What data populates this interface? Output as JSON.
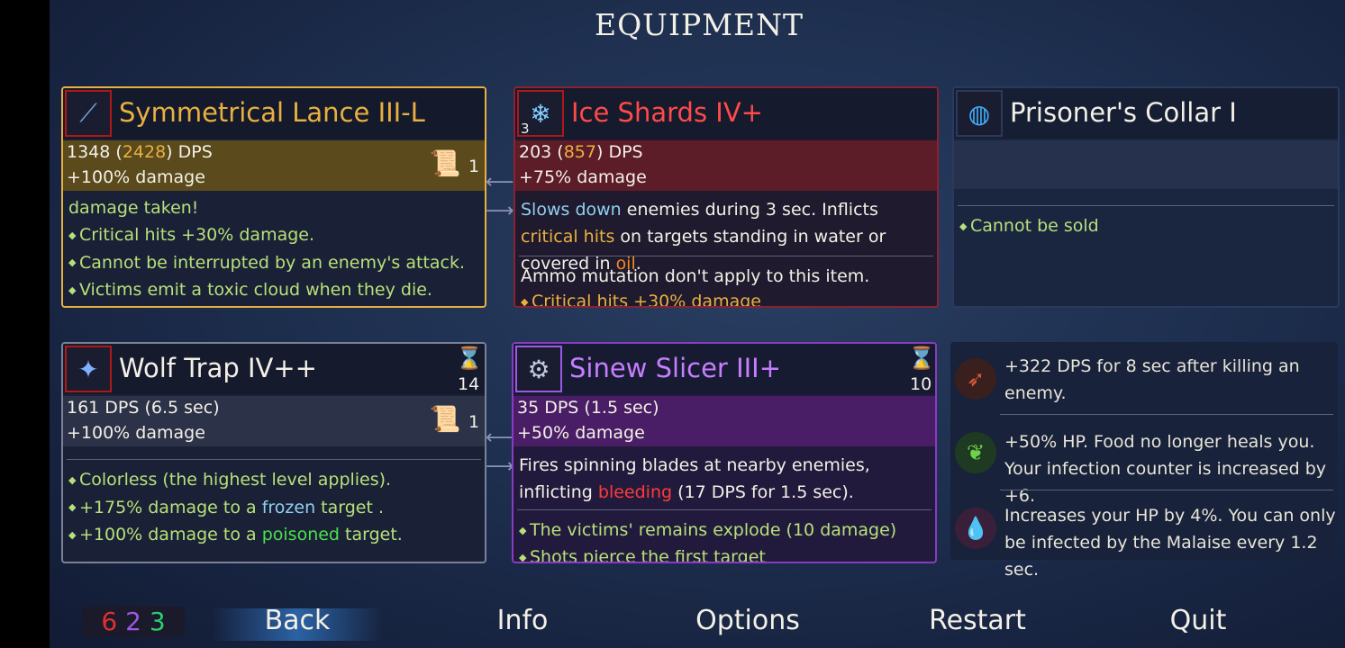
{
  "screen_title": "EQUIPMENT",
  "items": [
    {
      "name": "Symmetrical Lance III-L",
      "icon": "lance-icon",
      "dps_base": "1348",
      "dps_crit": "2428",
      "dps_suffix": "DPS",
      "damage_bonus": "+100% damage",
      "scroll_count": "1",
      "lines": [
        "damage taken!",
        "Critical hits +30% damage.",
        "Cannot be interrupted by an enemy's attack.",
        "Victims emit a toxic cloud when they die."
      ]
    },
    {
      "name": "Ice Shards IV+",
      "icon": "ice-shards-icon",
      "ammo": "3",
      "dps_base": "203",
      "dps_crit": "857",
      "dps_suffix": "DPS",
      "damage_bonus": "+75% damage",
      "desc_a": "Slows down",
      "desc_b": " enemies during 3 sec. Inflicts ",
      "desc_c": "critical hits",
      "desc_d": " on targets standing in water or covered in ",
      "desc_e": "oil",
      "desc_f": ".",
      "note": "Ammo mutation don't apply to this item.",
      "cut_line": "Critical hits +30% damage"
    },
    {
      "name": "Prisoner's Collar I",
      "icon": "collar-icon",
      "lines": [
        "Cannot be sold"
      ]
    },
    {
      "name": "Wolf Trap IV++",
      "icon": "wolf-trap-icon",
      "cooldown": "14",
      "dps": "161 DPS (6.5 sec)",
      "damage_bonus": "+100% damage",
      "scroll_count": "1",
      "line1": "Colorless (the highest level applies).",
      "line2_a": "+175% damage to a ",
      "line2_b": "frozen",
      "line2_c": " target .",
      "line3_a": "+100% damage to a ",
      "line3_b": "poisoned",
      "line3_c": " target."
    },
    {
      "name": "Sinew Slicer III+",
      "icon": "sinew-slicer-icon",
      "cooldown": "10",
      "dps": "35 DPS (1.5 sec)",
      "damage_bonus": "+50% damage",
      "desc_a": "Fires spinning blades at nearby enemies, inflicting ",
      "desc_b": "bleeding",
      "desc_c": " (17 DPS for 1.5 sec).",
      "line1": "The victims' remains explode (10 damage)",
      "cut_line": "Shots pierce the first target"
    }
  ],
  "mutations": [
    {
      "icon": "bow-skull-icon",
      "text": "+322 DPS for 8 sec after killing an enemy."
    },
    {
      "icon": "vine-heal-icon",
      "text": "+50% HP. Food no longer heals you. Your infection counter is increased by +6."
    },
    {
      "icon": "malaise-drop-icon",
      "text": "Increases your HP by 4%. You can only be infected by the Malaise every 1.2 sec."
    }
  ],
  "scrolls": {
    "brutality": "6",
    "tactics": "2",
    "survival": "3"
  },
  "menu": {
    "back": "Back",
    "info": "Info",
    "options": "Options",
    "restart": "Restart",
    "quit": "Quit"
  },
  "colors": {
    "brutality": "#e03030",
    "tactics": "#9b59e6",
    "survival": "#2ecc71",
    "gold": "#e8b040",
    "green_text": "#b7e07a",
    "blue_text": "#8fd0f0",
    "red_text": "#ff3a3a",
    "oil": "#f08a1e"
  }
}
